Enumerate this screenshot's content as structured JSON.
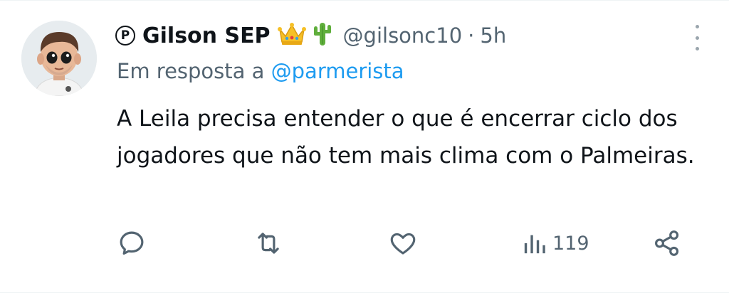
{
  "tweet": {
    "badge_letter": "P",
    "name": "Gilson SEP",
    "name_emojis": [
      "crown-icon",
      "cactus-icon"
    ],
    "handle": "@gilsonc10",
    "separator": "·",
    "time": "5h",
    "reply_prefix": "Em resposta a",
    "reply_to": "@parmerista",
    "text": "A Leila precisa entender o que é encerrar ciclo dos jogadores que não tem mais clima com o Palmeiras.",
    "actions": {
      "reply_icon": "comment-icon",
      "retweet_icon": "retweet-icon",
      "like_icon": "heart-icon",
      "views_icon": "views-icon",
      "views_count": "119",
      "share_icon": "share-icon"
    },
    "colors": {
      "text": "#0f1419",
      "secondary": "#536471",
      "link": "#1d9bf0"
    }
  }
}
